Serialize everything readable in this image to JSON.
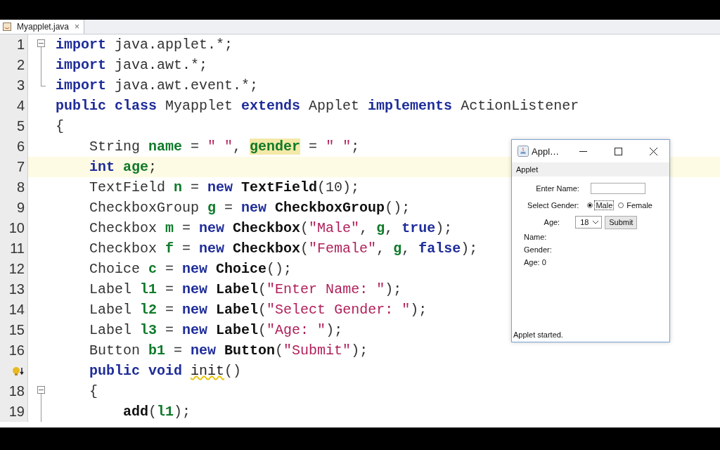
{
  "tabs": [
    {
      "label": "Myapplet.java",
      "selected": true,
      "close": "×"
    }
  ],
  "lines": [
    {
      "number": "1",
      "hint": false,
      "fold_marker": true,
      "fold_end": false,
      "current": false,
      "tokens": [
        {
          "kind": "kw",
          "text": "import "
        },
        {
          "kind": "plain",
          "text": "java.applet.*;"
        }
      ]
    },
    {
      "number": "2",
      "hint": false,
      "fold_marker": false,
      "fold_end": false,
      "current": false,
      "tokens": [
        {
          "kind": "kw",
          "text": "import "
        },
        {
          "kind": "plain",
          "text": "java.awt.*;"
        }
      ]
    },
    {
      "number": "3",
      "hint": false,
      "fold_marker": false,
      "fold_end": true,
      "current": false,
      "tokens": [
        {
          "kind": "kw",
          "text": "import "
        },
        {
          "kind": "plain",
          "text": "java.awt.event.*;"
        }
      ]
    },
    {
      "number": "4",
      "hint": false,
      "fold_marker": false,
      "fold_end": false,
      "current": false,
      "tokens": [
        {
          "kind": "kw",
          "text": "public class "
        },
        {
          "kind": "plain",
          "text": "Myapplet "
        },
        {
          "kind": "kw",
          "text": "extends "
        },
        {
          "kind": "plain",
          "text": "Applet "
        },
        {
          "kind": "kw",
          "text": "implements "
        },
        {
          "kind": "plain",
          "text": "ActionListener"
        }
      ]
    },
    {
      "number": "5",
      "hint": false,
      "fold_marker": false,
      "fold_end": false,
      "current": false,
      "tokens": [
        {
          "kind": "plain",
          "text": "{"
        }
      ]
    },
    {
      "number": "6",
      "hint": false,
      "fold_marker": false,
      "fold_end": false,
      "current": false,
      "tokens": [
        {
          "kind": "plain",
          "text": "    String "
        },
        {
          "kind": "field",
          "text": "name"
        },
        {
          "kind": "plain",
          "text": " = "
        },
        {
          "kind": "str",
          "text": "\" \""
        },
        {
          "kind": "plain",
          "text": ", "
        },
        {
          "kind": "field-mark",
          "text": "gender"
        },
        {
          "kind": "plain",
          "text": " = "
        },
        {
          "kind": "str",
          "text": "\" \""
        },
        {
          "kind": "plain",
          "text": ";"
        }
      ]
    },
    {
      "number": "7",
      "hint": false,
      "fold_marker": false,
      "fold_end": false,
      "current": true,
      "tokens": [
        {
          "kind": "kw",
          "text": "    int "
        },
        {
          "kind": "field",
          "text": "age"
        },
        {
          "kind": "plain",
          "text": ";"
        }
      ]
    },
    {
      "number": "8",
      "hint": false,
      "fold_marker": false,
      "fold_end": false,
      "current": false,
      "tokens": [
        {
          "kind": "plain",
          "text": "    TextField "
        },
        {
          "kind": "field",
          "text": "n"
        },
        {
          "kind": "plain",
          "text": " = "
        },
        {
          "kind": "kw",
          "text": "new "
        },
        {
          "kind": "method",
          "text": "TextField"
        },
        {
          "kind": "plain",
          "text": "(10);"
        }
      ]
    },
    {
      "number": "9",
      "hint": false,
      "fold_marker": false,
      "fold_end": false,
      "current": false,
      "tokens": [
        {
          "kind": "plain",
          "text": "    CheckboxGroup "
        },
        {
          "kind": "field",
          "text": "g"
        },
        {
          "kind": "plain",
          "text": " = "
        },
        {
          "kind": "kw",
          "text": "new "
        },
        {
          "kind": "method",
          "text": "CheckboxGroup"
        },
        {
          "kind": "plain",
          "text": "();"
        }
      ]
    },
    {
      "number": "10",
      "hint": false,
      "fold_marker": false,
      "fold_end": false,
      "current": false,
      "tokens": [
        {
          "kind": "plain",
          "text": "    Checkbox "
        },
        {
          "kind": "field",
          "text": "m"
        },
        {
          "kind": "plain",
          "text": " = "
        },
        {
          "kind": "kw",
          "text": "new "
        },
        {
          "kind": "method",
          "text": "Checkbox"
        },
        {
          "kind": "plain",
          "text": "("
        },
        {
          "kind": "str",
          "text": "\"Male\""
        },
        {
          "kind": "plain",
          "text": ", "
        },
        {
          "kind": "field",
          "text": "g"
        },
        {
          "kind": "plain",
          "text": ", "
        },
        {
          "kind": "kw",
          "text": "true"
        },
        {
          "kind": "plain",
          "text": ");"
        }
      ]
    },
    {
      "number": "11",
      "hint": false,
      "fold_marker": false,
      "fold_end": false,
      "current": false,
      "tokens": [
        {
          "kind": "plain",
          "text": "    Checkbox "
        },
        {
          "kind": "field",
          "text": "f"
        },
        {
          "kind": "plain",
          "text": " = "
        },
        {
          "kind": "kw",
          "text": "new "
        },
        {
          "kind": "method",
          "text": "Checkbox"
        },
        {
          "kind": "plain",
          "text": "("
        },
        {
          "kind": "str",
          "text": "\"Female\""
        },
        {
          "kind": "plain",
          "text": ", "
        },
        {
          "kind": "field",
          "text": "g"
        },
        {
          "kind": "plain",
          "text": ", "
        },
        {
          "kind": "kw",
          "text": "false"
        },
        {
          "kind": "plain",
          "text": ");"
        }
      ]
    },
    {
      "number": "12",
      "hint": false,
      "fold_marker": false,
      "fold_end": false,
      "current": false,
      "tokens": [
        {
          "kind": "plain",
          "text": "    Choice "
        },
        {
          "kind": "field",
          "text": "c"
        },
        {
          "kind": "plain",
          "text": " = "
        },
        {
          "kind": "kw",
          "text": "new "
        },
        {
          "kind": "method",
          "text": "Choice"
        },
        {
          "kind": "plain",
          "text": "();"
        }
      ]
    },
    {
      "number": "13",
      "hint": false,
      "fold_marker": false,
      "fold_end": false,
      "current": false,
      "tokens": [
        {
          "kind": "plain",
          "text": "    Label "
        },
        {
          "kind": "field",
          "text": "l1"
        },
        {
          "kind": "plain",
          "text": " = "
        },
        {
          "kind": "kw",
          "text": "new "
        },
        {
          "kind": "method",
          "text": "Label"
        },
        {
          "kind": "plain",
          "text": "("
        },
        {
          "kind": "str",
          "text": "\"Enter Name: \""
        },
        {
          "kind": "plain",
          "text": ");"
        }
      ]
    },
    {
      "number": "14",
      "hint": false,
      "fold_marker": false,
      "fold_end": false,
      "current": false,
      "tokens": [
        {
          "kind": "plain",
          "text": "    Label "
        },
        {
          "kind": "field",
          "text": "l2"
        },
        {
          "kind": "plain",
          "text": " = "
        },
        {
          "kind": "kw",
          "text": "new "
        },
        {
          "kind": "method",
          "text": "Label"
        },
        {
          "kind": "plain",
          "text": "("
        },
        {
          "kind": "str",
          "text": "\"Select Gender: \""
        },
        {
          "kind": "plain",
          "text": ");"
        }
      ]
    },
    {
      "number": "15",
      "hint": false,
      "fold_marker": false,
      "fold_end": false,
      "current": false,
      "tokens": [
        {
          "kind": "plain",
          "text": "    Label "
        },
        {
          "kind": "field",
          "text": "l3"
        },
        {
          "kind": "plain",
          "text": " = "
        },
        {
          "kind": "kw",
          "text": "new "
        },
        {
          "kind": "method",
          "text": "Label"
        },
        {
          "kind": "plain",
          "text": "("
        },
        {
          "kind": "str",
          "text": "\"Age: \""
        },
        {
          "kind": "plain",
          "text": ");"
        }
      ]
    },
    {
      "number": "16",
      "hint": false,
      "fold_marker": false,
      "fold_end": false,
      "current": false,
      "tokens": [
        {
          "kind": "plain",
          "text": "    Button "
        },
        {
          "kind": "field",
          "text": "b1"
        },
        {
          "kind": "plain",
          "text": " = "
        },
        {
          "kind": "kw",
          "text": "new "
        },
        {
          "kind": "method",
          "text": "Button"
        },
        {
          "kind": "plain",
          "text": "("
        },
        {
          "kind": "str",
          "text": "\"Submit\""
        },
        {
          "kind": "plain",
          "text": ");"
        }
      ]
    },
    {
      "hint": true,
      "fold_marker": false,
      "fold_end": false,
      "current": false,
      "tokens": [
        {
          "kind": "kw",
          "text": "    public void "
        },
        {
          "kind": "warn",
          "text": "init"
        },
        {
          "kind": "plain",
          "text": "()"
        }
      ]
    },
    {
      "number": "18",
      "hint": false,
      "fold_marker": true,
      "fold_end": false,
      "current": false,
      "tokens": [
        {
          "kind": "plain",
          "text": "    {"
        }
      ]
    },
    {
      "number": "19",
      "hint": false,
      "fold_marker": false,
      "fold_end": false,
      "current": false,
      "tokens": [
        {
          "kind": "method",
          "text": "        add"
        },
        {
          "kind": "plain",
          "text": "("
        },
        {
          "kind": "field",
          "text": "l1"
        },
        {
          "kind": "plain",
          "text": ");"
        }
      ]
    }
  ],
  "applet": {
    "title": "Appl…",
    "menu": "Applet",
    "name_label": "Enter Name:",
    "gender_label": "Select Gender:",
    "genders": [
      {
        "label": "Male",
        "selected": true
      },
      {
        "label": "Female",
        "selected": false
      }
    ],
    "age_label": "Age:",
    "age_value": "18",
    "submit": "Submit",
    "outputs": [
      "Name:",
      "Gender:",
      "Age: 0"
    ],
    "status": "Applet started."
  }
}
